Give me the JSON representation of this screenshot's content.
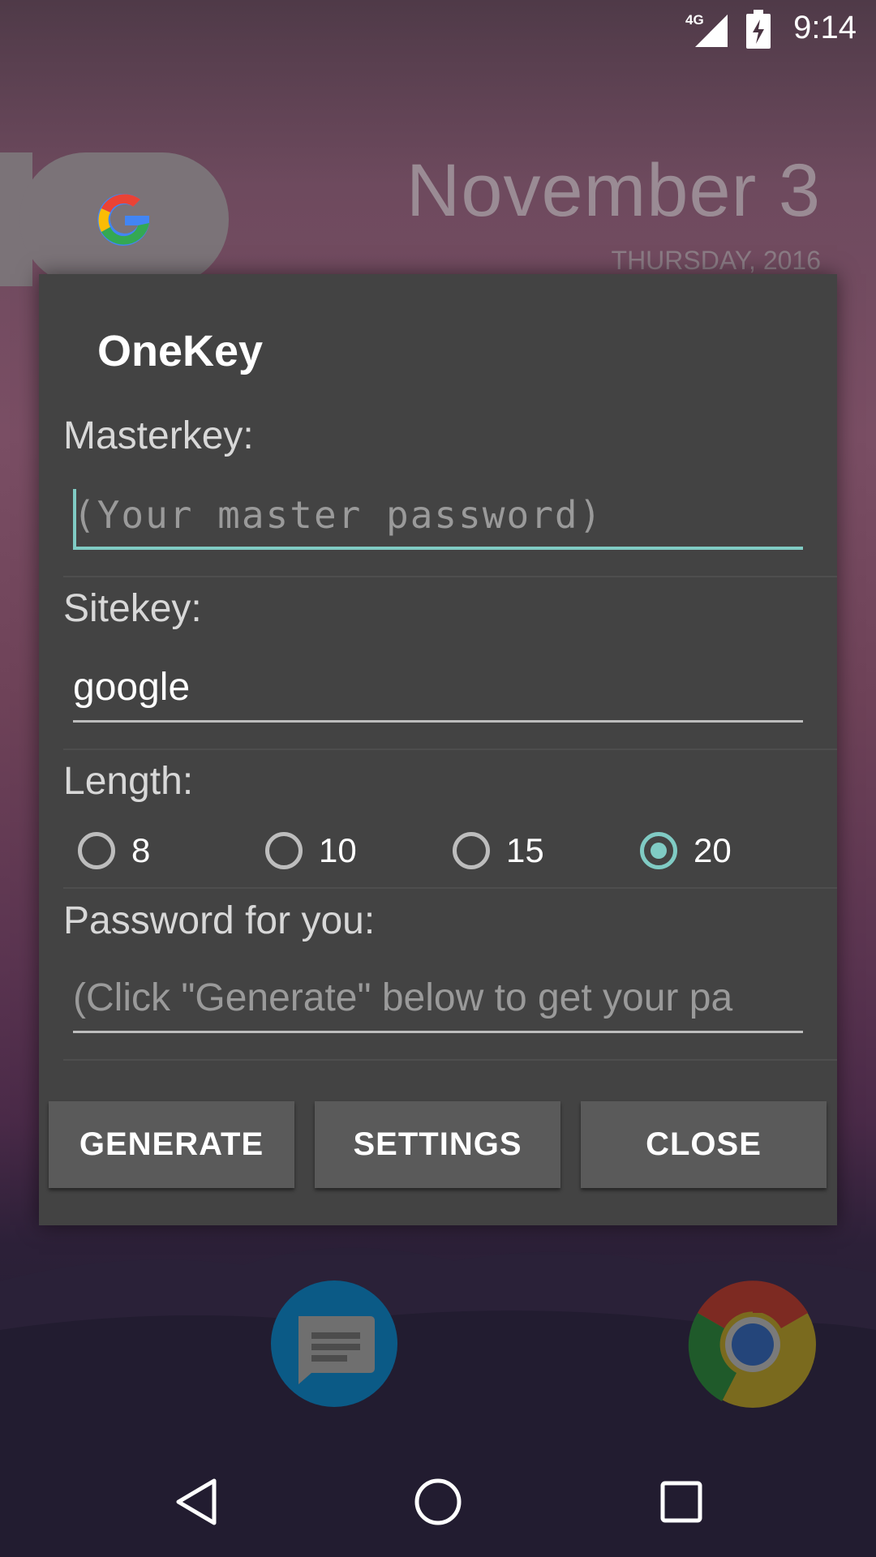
{
  "status_bar": {
    "time": "9:14",
    "network": "4G",
    "icons": [
      "signal-icon",
      "battery-charging-icon"
    ]
  },
  "home": {
    "date": "November 3",
    "day": "THURSDAY, 2016",
    "widgets": [
      "google-search-icon",
      "messages-app-icon",
      "chrome-app-icon"
    ]
  },
  "dialog": {
    "title": "OneKey",
    "masterkey": {
      "label": "Masterkey:",
      "value": "",
      "placeholder": "(Your master password)"
    },
    "sitekey": {
      "label": "Sitekey:",
      "value": "google"
    },
    "length": {
      "label": "Length:",
      "options": [
        "8",
        "10",
        "15",
        "20"
      ],
      "selected": "20"
    },
    "password": {
      "label": "Password for you:",
      "placeholder": "(Click \"Generate\" below to get your pa"
    },
    "buttons": {
      "generate": "GENERATE",
      "settings": "SETTINGS",
      "close": "CLOSE"
    }
  },
  "colors": {
    "accent": "#80cbc4",
    "dialog_bg": "#434343",
    "button_bg": "#5a5a5a"
  },
  "nav_bar": {
    "icons": [
      "back-icon",
      "home-icon",
      "recents-icon"
    ]
  }
}
